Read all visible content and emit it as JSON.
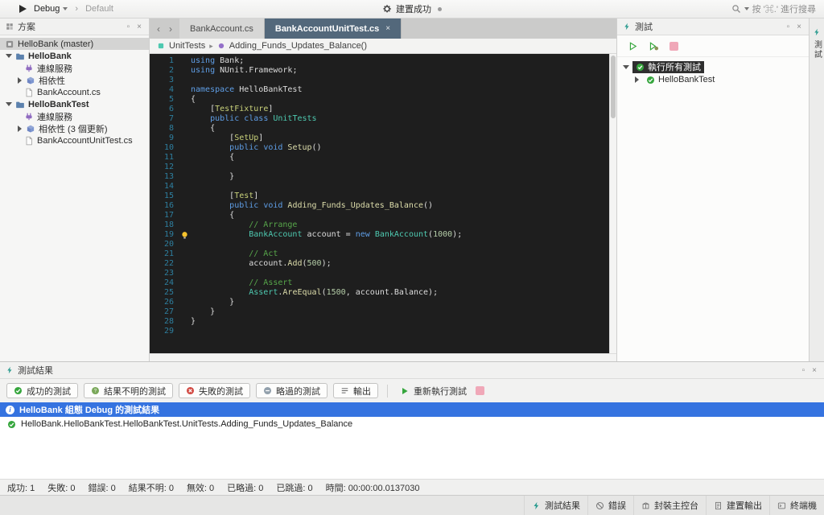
{
  "toolbar": {
    "config": "Debug",
    "target": "Default",
    "build_status": "建置成功",
    "search_hint": "按 '⌘.' 進行搜尋"
  },
  "solution_pad": {
    "title": "方案",
    "tree": [
      {
        "label": "HelloBank (master)",
        "icon": "solution",
        "disc": "none",
        "level": 0,
        "selected": true
      },
      {
        "label": "HelloBank",
        "icon": "folder",
        "disc": "open",
        "level": 0,
        "bold": true
      },
      {
        "label": "連線服務",
        "icon": "plug",
        "disc": "none",
        "level": 1
      },
      {
        "label": "相依性",
        "icon": "cube",
        "disc": "closed",
        "level": 1
      },
      {
        "label": "BankAccount.cs",
        "icon": "file",
        "disc": "none",
        "level": 1
      },
      {
        "label": "HelloBankTest",
        "icon": "folder",
        "disc": "open",
        "level": 0,
        "bold": true
      },
      {
        "label": "連線服務",
        "icon": "plug",
        "disc": "none",
        "level": 1
      },
      {
        "label": "相依性 (3 個更新)",
        "icon": "cube",
        "disc": "closed",
        "level": 1
      },
      {
        "label": "BankAccountUnitTest.cs",
        "icon": "file",
        "disc": "none",
        "level": 1
      }
    ]
  },
  "editor": {
    "tabs": [
      {
        "label": "BankAccount.cs",
        "active": false
      },
      {
        "label": "BankAccountUnitTest.cs",
        "active": true
      }
    ],
    "breadcrumb": [
      {
        "label": "UnitTests"
      },
      {
        "label": "Adding_Funds_Updates_Balance()"
      }
    ],
    "bulb_line": 19,
    "code": [
      [
        [
          "kw",
          "using"
        ],
        [
          "pl",
          " Bank;"
        ]
      ],
      [
        [
          "kw",
          "using"
        ],
        [
          "pl",
          " NUnit.Framework;"
        ]
      ],
      [],
      [
        [
          "kw",
          "namespace"
        ],
        [
          "pl",
          " HelloBankTest"
        ]
      ],
      [
        [
          "pl",
          "{"
        ]
      ],
      [
        [
          "pl",
          "    ["
        ],
        [
          "at",
          "TestFixture"
        ],
        [
          "pl",
          "]"
        ]
      ],
      [
        [
          "pl",
          "    "
        ],
        [
          "kw",
          "public class "
        ],
        [
          "ty",
          "UnitTests"
        ]
      ],
      [
        [
          "pl",
          "    {"
        ]
      ],
      [
        [
          "pl",
          "        ["
        ],
        [
          "at",
          "SetUp"
        ],
        [
          "pl",
          "]"
        ]
      ],
      [
        [
          "pl",
          "        "
        ],
        [
          "kw",
          "public void "
        ],
        [
          "me",
          "Setup"
        ],
        [
          "pl",
          "()"
        ]
      ],
      [
        [
          "pl",
          "        {"
        ]
      ],
      [],
      [
        [
          "pl",
          "        }"
        ]
      ],
      [],
      [
        [
          "pl",
          "        ["
        ],
        [
          "at",
          "Test"
        ],
        [
          "pl",
          "]"
        ]
      ],
      [
        [
          "pl",
          "        "
        ],
        [
          "kw",
          "public void "
        ],
        [
          "me",
          "Adding_Funds_Updates_Balance"
        ],
        [
          "pl",
          "()"
        ]
      ],
      [
        [
          "pl",
          "        {"
        ]
      ],
      [
        [
          "pl",
          "            "
        ],
        [
          "cm",
          "// Arrange"
        ]
      ],
      [
        [
          "pl",
          "            "
        ],
        [
          "ty",
          "BankAccount"
        ],
        [
          "pl",
          " account = "
        ],
        [
          "kw",
          "new"
        ],
        [
          "pl",
          " "
        ],
        [
          "ty",
          "BankAccount"
        ],
        [
          "pl",
          "("
        ],
        [
          "nu",
          "1000"
        ],
        [
          "pl",
          ");"
        ]
      ],
      [],
      [
        [
          "pl",
          "            "
        ],
        [
          "cm",
          "// Act"
        ]
      ],
      [
        [
          "pl",
          "            account."
        ],
        [
          "me",
          "Add"
        ],
        [
          "pl",
          "("
        ],
        [
          "nu",
          "500"
        ],
        [
          "pl",
          ");"
        ]
      ],
      [],
      [
        [
          "pl",
          "            "
        ],
        [
          "cm",
          "// Assert"
        ]
      ],
      [
        [
          "pl",
          "            "
        ],
        [
          "ty",
          "Assert"
        ],
        [
          "pl",
          "."
        ],
        [
          "me",
          "AreEqual"
        ],
        [
          "pl",
          "("
        ],
        [
          "nu",
          "1500"
        ],
        [
          "pl",
          ", account.Balance);"
        ]
      ],
      [
        [
          "pl",
          "        }"
        ]
      ],
      [
        [
          "pl",
          "    }"
        ]
      ],
      [
        [
          "pl",
          "}"
        ]
      ],
      []
    ]
  },
  "tests_pad": {
    "title": "測試",
    "tree": [
      {
        "label": "執行所有測試",
        "disc": "open",
        "level": 0,
        "selected": true
      },
      {
        "label": "HelloBankTest",
        "disc": "closed",
        "level": 1,
        "selected": false
      }
    ]
  },
  "dock": {
    "vertical_tab": "測試"
  },
  "results_pad": {
    "title": "測試結果",
    "filters": [
      {
        "label": "成功的測試",
        "icon": "check-circle"
      },
      {
        "label": "結果不明的測試",
        "icon": "question-circle"
      },
      {
        "label": "失敗的測試",
        "icon": "x-circle"
      },
      {
        "label": "略過的測試",
        "icon": "dash-circle"
      },
      {
        "label": "輸出",
        "icon": "list-lines"
      }
    ],
    "rerun_label": "重新執行測試",
    "info_row": "HelloBank 組態 Debug 的測試結果",
    "result_row": "HelloBank.HelloBankTest.HelloBankTest.UnitTests.Adding_Funds_Updates_Balance",
    "summary": [
      "成功: 1",
      "失敗: 0",
      "錯誤: 0",
      "結果不明: 0",
      "無效: 0",
      "已略過: 0",
      "已跳過: 0",
      "時間: 00:00:00.0137030"
    ]
  },
  "status_bar": {
    "items": [
      {
        "label": "測試結果",
        "icon": "lightning"
      },
      {
        "label": "錯誤",
        "icon": "no-entry"
      },
      {
        "label": "封裝主控台",
        "icon": "package-box"
      },
      {
        "label": "建置輸出",
        "icon": "document-lines"
      },
      {
        "label": "終端機",
        "icon": "terminal-window"
      }
    ]
  },
  "colors": {
    "accent_blue": "#3573e0",
    "success_green": "#36a63d",
    "fail_red": "#d24a43",
    "stop_pink": "#f0a8b8",
    "editor_bg": "#1e1e1e",
    "active_tab": "#53687b"
  }
}
